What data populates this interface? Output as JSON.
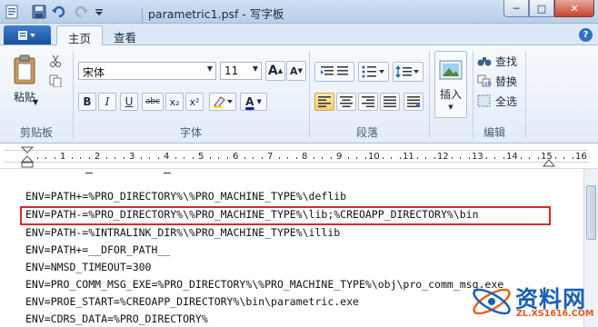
{
  "window": {
    "title": "parametric1.psf - 写字板",
    "buttons": {
      "minimize": "─",
      "maximize": "□",
      "close": "✕"
    }
  },
  "quick_access": [
    "save-icon",
    "undo-icon",
    "redo-icon",
    "customize-icon"
  ],
  "tabs": [
    {
      "label": "主页",
      "active": true
    },
    {
      "label": "查看",
      "active": false
    }
  ],
  "ribbon": {
    "clipboard": {
      "label": "剪贴板",
      "paste": "粘贴"
    },
    "font": {
      "label": "字体",
      "family": "宋体",
      "size": "11",
      "grow": "A",
      "shrink": "A",
      "bold": "B",
      "italic": "I",
      "underline": "U",
      "strike": "abc",
      "subscript": "x₂",
      "superscript": "x²",
      "color": "A"
    },
    "paragraph": {
      "label": "段落"
    },
    "insert": {
      "label": "插入"
    },
    "editing": {
      "label": "编辑",
      "find": "查找",
      "replace": "替换",
      "select_all": "全选"
    }
  },
  "ruler": {
    "labels": [
      "1",
      "2",
      "3",
      "4",
      "5",
      "6",
      "7",
      "8",
      "9",
      "10",
      "11",
      "12",
      "13",
      "14",
      "15",
      "16"
    ]
  },
  "document": {
    "lines": [
      "ENV=PATH+=%PRO_DIRECTORY%\\%PRO_MACHINE_TYPE%\\deflib",
      "ENV=PATH-=%PRO_DIRECTORY%\\%PRO_MACHINE_TYPE%\\lib;%CREOAPP_DIRECTORY%\\bin",
      "ENV=PATH-=%INTRALINK_DIR%\\%PRO_MACHINE_TYPE%\\illib",
      "ENV=PATH+=__DFOR_PATH__",
      "ENV=NMSD_TIMEOUT=300",
      "ENV=PRO_COMM_MSG_EXE=%PRO_DIRECTORY%\\%PRO_MACHINE_TYPE%\\obj\\pro_comm_msg.exe",
      "ENV=PROE_START=%CREOAPP_DIRECTORY%\\bin\\parametric.exe",
      "ENV=CDRS_DATA=%PRO_DIRECTORY%"
    ]
  },
  "watermark": {
    "text": "资料网",
    "url": "ZL.XS1616.COM"
  },
  "colors": {
    "highlight": "#d42b2b",
    "accent": "#2f6fc6"
  }
}
